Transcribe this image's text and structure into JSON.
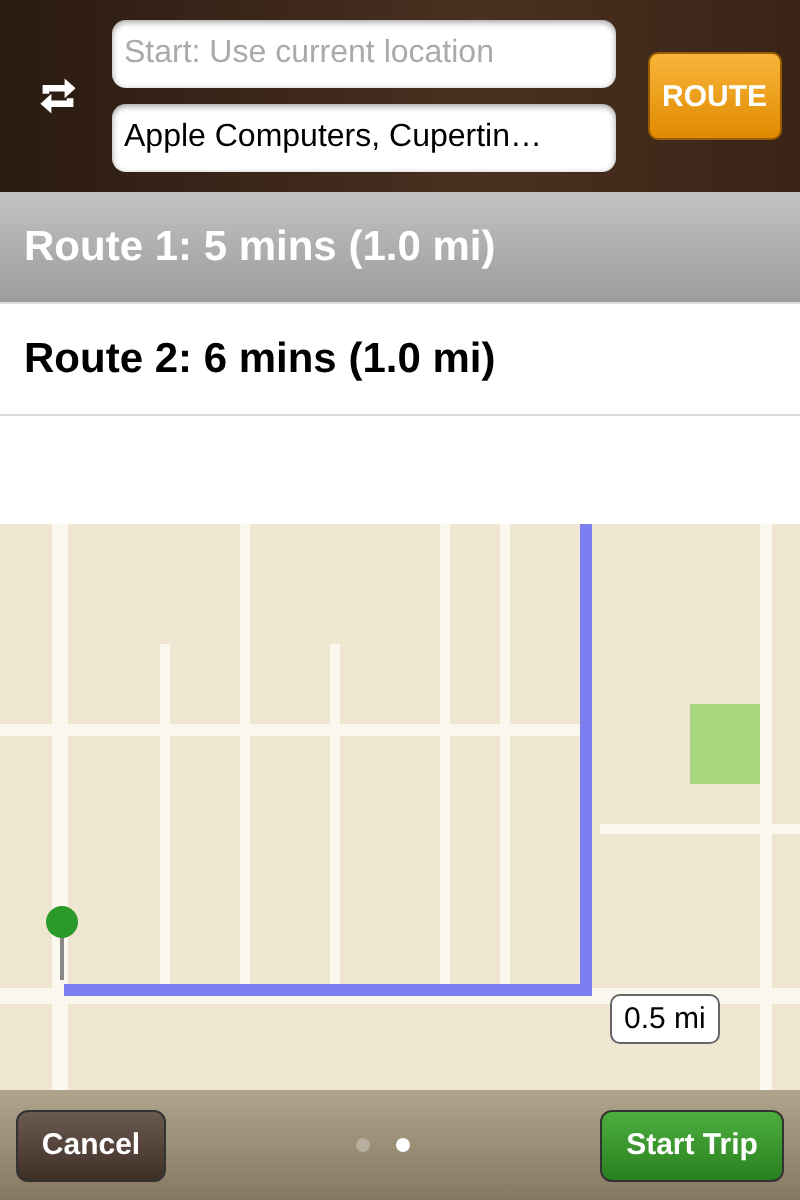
{
  "search": {
    "start": {
      "placeholder": "Start: Use current location"
    },
    "end": {
      "value": "Apple Computers, Cupertin…"
    },
    "route_button": "ROUTE"
  },
  "routes": [
    {
      "label": "Route 1: 5 mins (1.0 mi)",
      "selected": true
    },
    {
      "label": "Route 2: 6 mins (1.0 mi)",
      "selected": false
    }
  ],
  "map": {
    "distance_label": "0.5 mi"
  },
  "toolbar": {
    "cancel": "Cancel",
    "pages": [
      {
        "selected": false
      },
      {
        "selected": true
      }
    ],
    "start_trip": "Start Trip"
  }
}
